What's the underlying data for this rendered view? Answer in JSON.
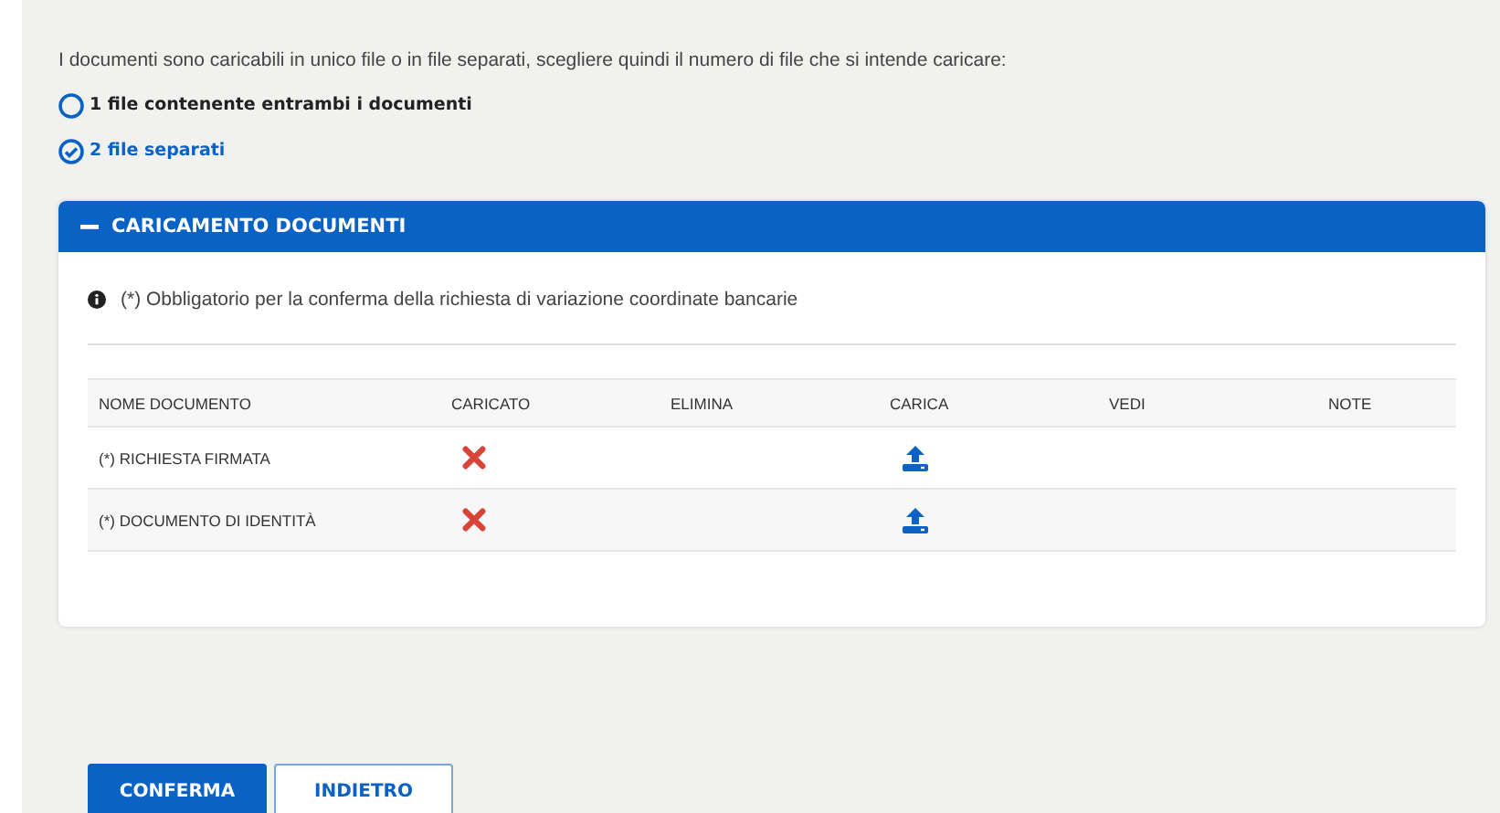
{
  "intro": "I documenti sono caricabili in unico file o in file separati, scegliere quindi il numero di file che si intende caricare:",
  "options": [
    {
      "label": "1 file contenente entrambi i documenti",
      "selected": false
    },
    {
      "label": "2 file separati",
      "selected": true
    }
  ],
  "panel": {
    "title": "CARICAMENTO DOCUMENTI",
    "expanded": true,
    "note": "(*) Obbligatorio per la conferma della richiesta di variazione coordinate bancarie",
    "columns": [
      "NOME DOCUMENTO",
      "CARICATO",
      "ELIMINA",
      "CARICA",
      "VEDI",
      "NOTE"
    ],
    "rows": [
      {
        "name": "(*) RICHIESTA FIRMATA",
        "uploaded": false
      },
      {
        "name": "(*) DOCUMENTO DI IDENTITÀ",
        "uploaded": false
      }
    ]
  },
  "buttons": [
    "CONFERMA",
    "INDIETRO"
  ]
}
